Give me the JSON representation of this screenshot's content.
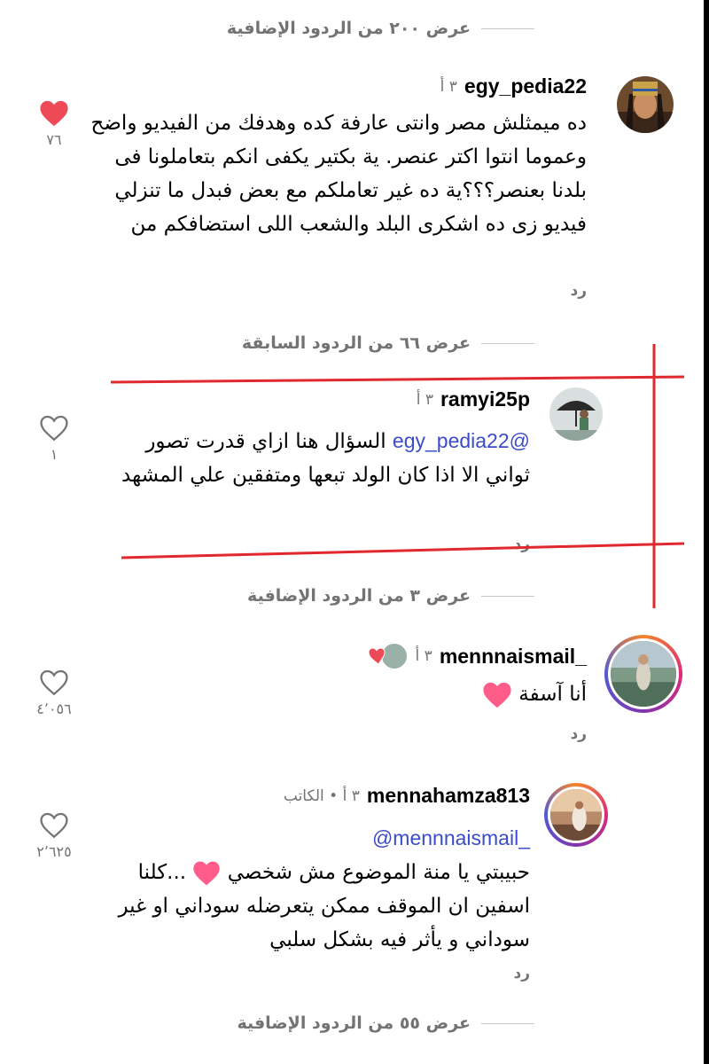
{
  "view_more_1": "عرض ٢٠٠ من الردود الإضافية",
  "comment1": {
    "username": "egy_pedia22",
    "time": "٣ أ",
    "text": "ده ميمثلش مصر وانتى عارفة كده وهدفك من الفيديو واضح وعموما انتوا اكتر عنصر.  ية بكتير يكفى انكم بتعاملونا فى بلدنا بعنصر؟؟؟ية ده غير تعاملكم مع بعض فبدل ما تنزلي فيديو زى ده اشكرى البلد والشعب اللى استضافكم من",
    "reply": "رد",
    "likes": "٧٦",
    "liked": true
  },
  "view_previous": "عرض ٦٦ من الردود السابقة",
  "comment2": {
    "username": "ramyi25p",
    "time": "٣ أ",
    "mention": "@egy_pedia22",
    "text_first": " السؤال هنا ازاي قدرت",
    "text_rest": "تصور ثواني الا اذا كان الولد تبعها ومتفقين علي المشهد",
    "reply": "رد",
    "likes": "١",
    "liked": false
  },
  "view_more_2": "عرض ٣ من الردود الإضافية",
  "comment3": {
    "username": "mennnaismail_",
    "time": "٣ أ",
    "text": "أنا آسفة",
    "reply": "رد",
    "likes": "٤٬٠٥٦",
    "liked": false
  },
  "comment4": {
    "username": "mennahamza813",
    "time": "٣ أ",
    "author_badge": "الكاتب",
    "mention": "@mennnaismail_",
    "text_line1": "حبيبتي يا منة الموضوع مش شخصي",
    "text_rest": "...كلنا اسفين ان الموقف ممكن يتعرضله سوداني او غير سوداني و يأثر فيه بشكل سلبي",
    "reply": "رد",
    "likes": "٢٬٦٢٥",
    "liked": false
  },
  "view_more_3": "عرض ٥٥ من الردود الإضافية",
  "colors": {
    "like_red": "#ed4956",
    "muted": "#737373",
    "mention": "#3b4cca",
    "annotation": "#e0282e"
  }
}
